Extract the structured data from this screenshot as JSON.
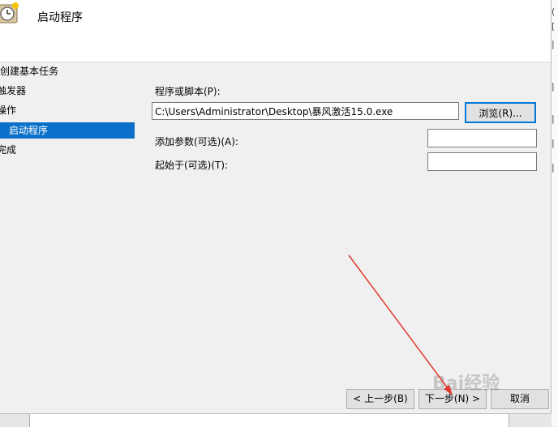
{
  "dialog": {
    "title": "启动程序"
  },
  "steps": [
    {
      "label": "创建基本任务"
    },
    {
      "label": "触发器"
    },
    {
      "label": "操作"
    },
    {
      "label": "启动程序"
    },
    {
      "label": "完成"
    }
  ],
  "form": {
    "program_label": "程序或脚本(P):",
    "program_value": "C:\\Users\\Administrator\\Desktop\\暴风激活15.0.exe",
    "browse_label": "浏览(R)...",
    "args_label": "添加参数(可选)(A):",
    "args_value": "",
    "start_in_label": "起始于(可选)(T):",
    "start_in_value": ""
  },
  "buttons": {
    "back": "< 上一步(B)",
    "next": "下一步(N) >",
    "cancel": "取消"
  },
  "watermark": "Bai经验",
  "colors": {
    "accent": "#0b70c9",
    "arrow": "#e03a2e"
  }
}
